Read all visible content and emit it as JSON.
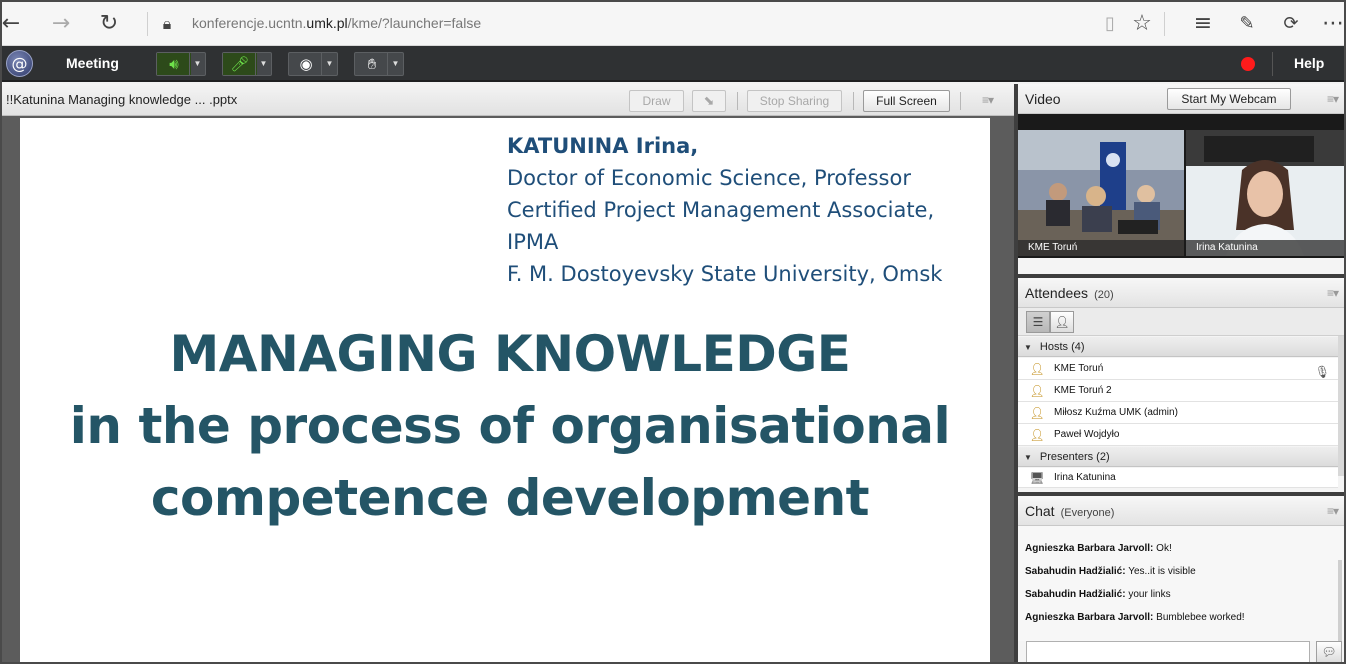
{
  "browser": {
    "back_icon": "arrow-left-icon",
    "url_prefix": "konferencje.ucntn.",
    "url_domain": "umk.pl",
    "url_suffix": "/kme/?launcher=false"
  },
  "toolbar": {
    "meeting_label": "Meeting",
    "help_label": "Help",
    "colors": {
      "audio_active": "#6ee24a",
      "record": "#ff1b1b"
    }
  },
  "share": {
    "title": "!!Katunina Managing knowledge ... .pptx",
    "draw_label": "Draw",
    "stop_sharing_label": "Stop Sharing",
    "full_screen_label": "Full Screen",
    "slide": {
      "author_name": "KATUNINA Irina,",
      "author_line1": "Doctor of Economic Science, Professor",
      "author_line2": "Certified Project Management Associate, IPMA",
      "author_line3": "F. M. Dostoyevsky State University, Omsk",
      "title_line1": "MANAGING KNOWLEDGE",
      "title_line2": "in the process of organisational",
      "title_line3": "competence development",
      "text_color": "#245566"
    }
  },
  "video": {
    "title": "Video",
    "start_webcam_label": "Start My Webcam",
    "feeds": [
      {
        "caption": "KME Toruń"
      },
      {
        "caption": "Irina Katunina"
      }
    ]
  },
  "attendees": {
    "title": "Attendees",
    "count": "(20)",
    "groups": [
      {
        "label": "Hosts (4)",
        "people": [
          "KME Toruń",
          "KME Toruń 2",
          "Miłosz Kuźma UMK (admin)",
          "Paweł Wojdyło"
        ]
      },
      {
        "label": "Presenters (2)",
        "people": [
          "Irina Katunina"
        ]
      }
    ]
  },
  "chat": {
    "title": "Chat",
    "scope": "(Everyone)",
    "messages": [
      {
        "sender": "Agnieszka Barbara Jarvoll:",
        "text": "Ok!"
      },
      {
        "sender": "Sabahudin  Hadžialić:",
        "text": "Yes..it is visible"
      },
      {
        "sender": "Sabahudin  Hadžialić:",
        "text": "your links"
      },
      {
        "sender": "Agnieszka Barbara Jarvoll:",
        "text": "Bumblebee worked!"
      }
    ]
  }
}
